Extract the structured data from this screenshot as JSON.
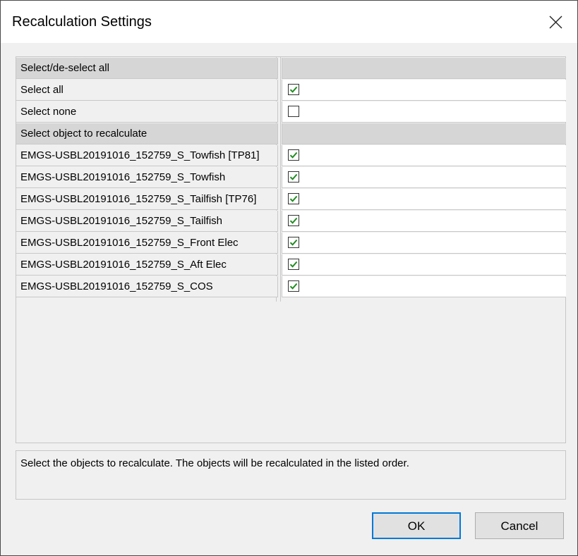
{
  "dialog": {
    "title": "Recalculation Settings"
  },
  "grid": {
    "rows": [
      {
        "type": "category",
        "label": "Select/de-select all"
      },
      {
        "type": "item",
        "label": "Select all",
        "checked": true
      },
      {
        "type": "item",
        "label": "Select none",
        "checked": false
      },
      {
        "type": "category",
        "label": "Select object to recalculate"
      },
      {
        "type": "item",
        "label": "EMGS-USBL20191016_152759_S_Towfish [TP81]",
        "checked": true
      },
      {
        "type": "item",
        "label": "EMGS-USBL20191016_152759_S_Towfish",
        "checked": true
      },
      {
        "type": "item",
        "label": "EMGS-USBL20191016_152759_S_Tailfish [TP76]",
        "checked": true
      },
      {
        "type": "item",
        "label": "EMGS-USBL20191016_152759_S_Tailfish",
        "checked": true
      },
      {
        "type": "item",
        "label": "EMGS-USBL20191016_152759_S_Front Elec",
        "checked": true
      },
      {
        "type": "item",
        "label": "EMGS-USBL20191016_152759_S_Aft Elec",
        "checked": true
      },
      {
        "type": "item",
        "label": "EMGS-USBL20191016_152759_S_COS",
        "checked": true
      }
    ]
  },
  "description": {
    "text": "Select the objects to recalculate. The objects will be recalculated in the listed order."
  },
  "buttons": {
    "ok": "OK",
    "cancel": "Cancel"
  },
  "colors": {
    "checkmark": "#1e8c1e",
    "default_button_border": "#0078d7",
    "category_bg": "#d6d6d6"
  }
}
